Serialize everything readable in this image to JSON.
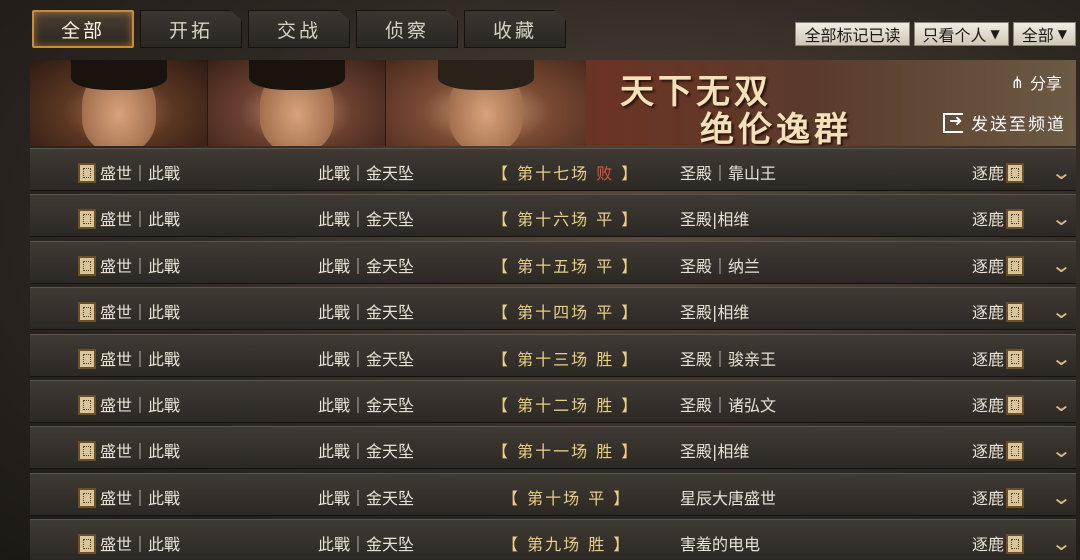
{
  "tabs": [
    "全部",
    "开拓",
    "交战",
    "侦察",
    "收藏"
  ],
  "top_actions": {
    "mark_read": "全部标记已读",
    "personal": "只看个人",
    "filter": "全部"
  },
  "banner": {
    "slogan_line1": "天下无双",
    "slogan_line2": "绝伦逸群",
    "share": "分享",
    "send": "发送至频道"
  },
  "rows": [
    {
      "left": "盛世｜此戰",
      "mid": "此戰｜金天坠",
      "match_pre": "【 第十七场 ",
      "result": "败",
      "match_post": " 】",
      "right": "圣殿｜靠山王",
      "tag": "逐鹿"
    },
    {
      "left": "盛世｜此戰",
      "mid": "此戰｜金天坠",
      "match_pre": "【 第十六场 ",
      "result": "平",
      "match_post": " 】",
      "right": "圣殿|相维",
      "tag": "逐鹿"
    },
    {
      "left": "盛世｜此戰",
      "mid": "此戰｜金天坠",
      "match_pre": "【 第十五场 ",
      "result": "平",
      "match_post": " 】",
      "right": "圣殿｜纳兰",
      "tag": "逐鹿"
    },
    {
      "left": "盛世｜此戰",
      "mid": "此戰｜金天坠",
      "match_pre": "【 第十四场 ",
      "result": "平",
      "match_post": " 】",
      "right": "圣殿|相维",
      "tag": "逐鹿"
    },
    {
      "left": "盛世｜此戰",
      "mid": "此戰｜金天坠",
      "match_pre": "【 第十三场 ",
      "result": "胜",
      "match_post": " 】",
      "right": "圣殿｜骏亲王",
      "tag": "逐鹿"
    },
    {
      "left": "盛世｜此戰",
      "mid": "此戰｜金天坠",
      "match_pre": "【 第十二场 ",
      "result": "胜",
      "match_post": " 】",
      "right": "圣殿｜诸弘文",
      "tag": "逐鹿"
    },
    {
      "left": "盛世｜此戰",
      "mid": "此戰｜金天坠",
      "match_pre": "【 第十一场 ",
      "result": "胜",
      "match_post": " 】",
      "right": "圣殿|相维",
      "tag": "逐鹿"
    },
    {
      "left": "盛世｜此戰",
      "mid": "此戰｜金天坠",
      "match_pre": "【 第十场 ",
      "result": "平",
      "match_post": " 】",
      "right": "星辰大唐盛世",
      "tag": "逐鹿"
    },
    {
      "left": "盛世｜此戰",
      "mid": "此戰｜金天坠",
      "match_pre": "【 第九场 ",
      "result": "胜",
      "match_post": " 】",
      "right": "害羞的电电",
      "tag": "逐鹿"
    }
  ]
}
